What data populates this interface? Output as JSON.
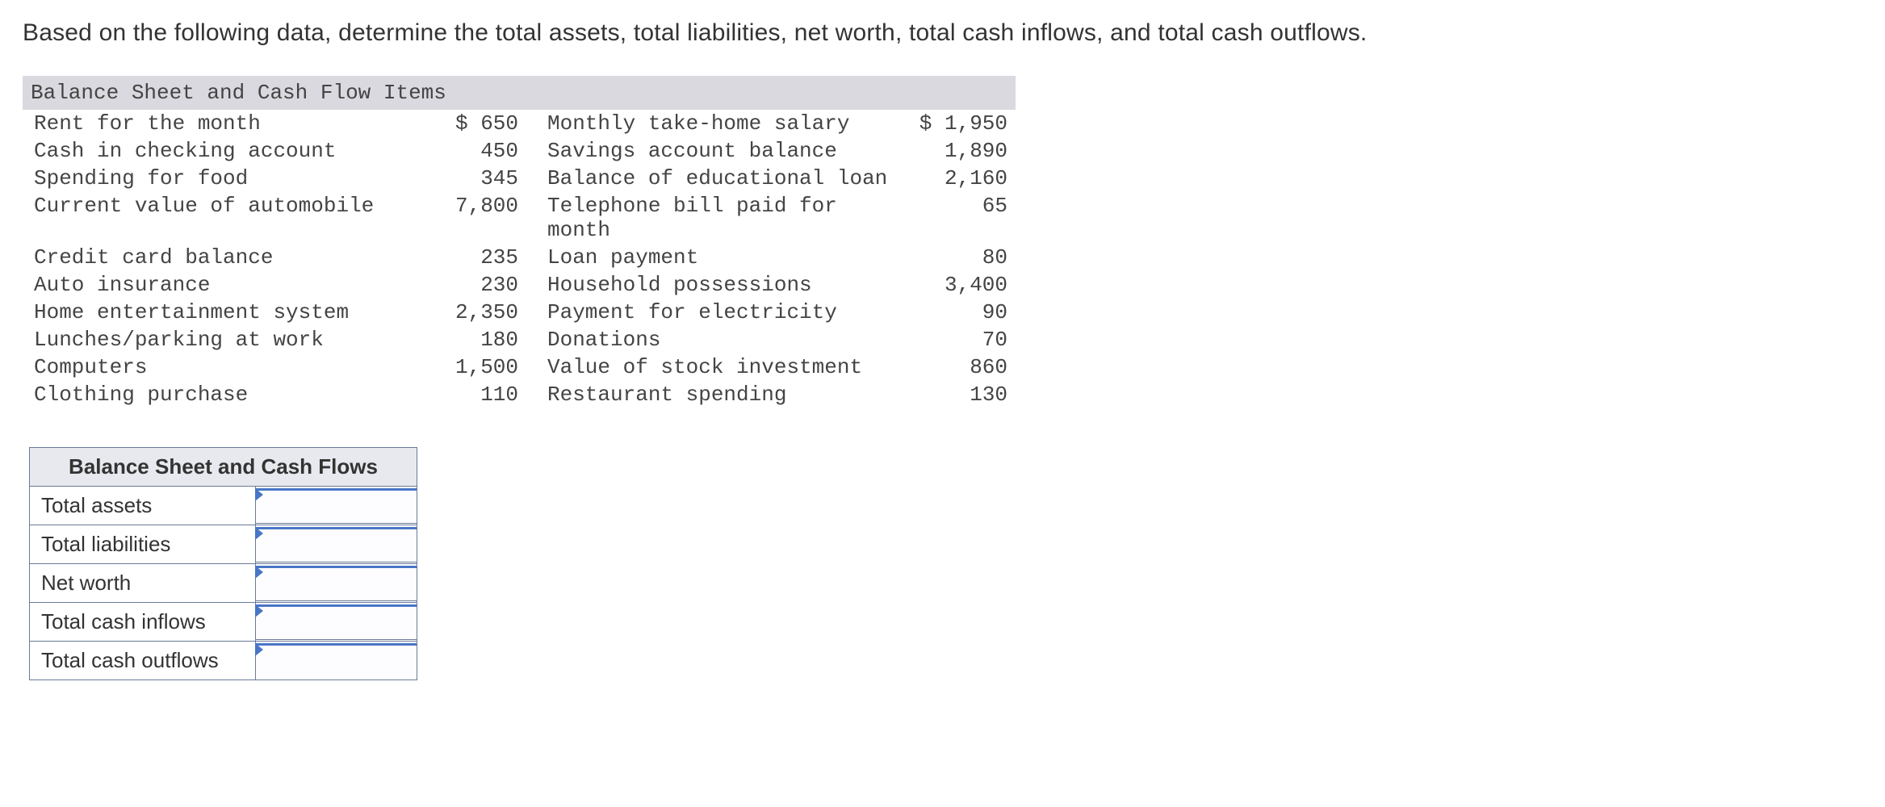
{
  "prompt": "Based on the following data, determine the total assets, total liabilities, net worth, total cash inflows, and total cash outflows.",
  "data_title": "Balance Sheet and Cash Flow Items",
  "rows": [
    {
      "l1": "Rent for the month",
      "v1": "$ 650",
      "l2": "Monthly take-home salary",
      "v2": "$ 1,950"
    },
    {
      "l1": "Cash in checking account",
      "v1": "450",
      "l2": "Savings account balance",
      "v2": "1,890"
    },
    {
      "l1": "Spending for food",
      "v1": "345",
      "l2": "Balance of educational loan",
      "v2": "2,160"
    },
    {
      "l1": "Current value of automobile",
      "v1": "7,800",
      "l2": "Telephone bill paid for month",
      "v2": "65"
    },
    {
      "l1": "Credit card balance",
      "v1": "235",
      "l2": "Loan payment",
      "v2": "80"
    },
    {
      "l1": "Auto insurance",
      "v1": "230",
      "l2": "Household possessions",
      "v2": "3,400"
    },
    {
      "l1": "Home entertainment system",
      "v1": "2,350",
      "l2": "Payment for electricity",
      "v2": "90"
    },
    {
      "l1": "Lunches/parking at work",
      "v1": "180",
      "l2": "Donations",
      "v2": "70"
    },
    {
      "l1": "Computers",
      "v1": "1,500",
      "l2": "Value of stock investment",
      "v2": "860"
    },
    {
      "l1": "Clothing purchase",
      "v1": "110",
      "l2": "Restaurant spending",
      "v2": "130"
    }
  ],
  "answers": {
    "title": "Balance Sheet and Cash Flows",
    "fields": [
      {
        "label": "Total assets"
      },
      {
        "label": "Total liabilities"
      },
      {
        "label": "Net worth"
      },
      {
        "label": "Total cash inflows"
      },
      {
        "label": "Total cash outflows"
      }
    ]
  },
  "chart_data": {
    "type": "table",
    "title": "Balance Sheet and Cash Flow Items",
    "items": [
      {
        "name": "Rent for the month",
        "amount": 650
      },
      {
        "name": "Cash in checking account",
        "amount": 450
      },
      {
        "name": "Spending for food",
        "amount": 345
      },
      {
        "name": "Current value of automobile",
        "amount": 7800
      },
      {
        "name": "Credit card balance",
        "amount": 235
      },
      {
        "name": "Auto insurance",
        "amount": 230
      },
      {
        "name": "Home entertainment system",
        "amount": 2350
      },
      {
        "name": "Lunches/parking at work",
        "amount": 180
      },
      {
        "name": "Computers",
        "amount": 1500
      },
      {
        "name": "Clothing purchase",
        "amount": 110
      },
      {
        "name": "Monthly take-home salary",
        "amount": 1950
      },
      {
        "name": "Savings account balance",
        "amount": 1890
      },
      {
        "name": "Balance of educational loan",
        "amount": 2160
      },
      {
        "name": "Telephone bill paid for month",
        "amount": 65
      },
      {
        "name": "Loan payment",
        "amount": 80
      },
      {
        "name": "Household possessions",
        "amount": 3400
      },
      {
        "name": "Payment for electricity",
        "amount": 90
      },
      {
        "name": "Donations",
        "amount": 70
      },
      {
        "name": "Value of stock investment",
        "amount": 860
      },
      {
        "name": "Restaurant spending",
        "amount": 130
      }
    ]
  }
}
